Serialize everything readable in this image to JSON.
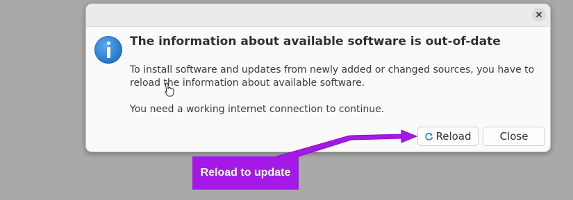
{
  "dialog": {
    "close_icon": "close-icon",
    "info_icon": "info-icon",
    "heading": "The information about available software is out-of-date",
    "paragraph1": "To install software and updates from newly added or changed sources, you have to reload the information about available software.",
    "paragraph2": "You need a working internet connection to continue.",
    "buttons": {
      "reload_label": "Reload",
      "reload_icon": "refresh-icon",
      "close_label": "Close"
    }
  },
  "annotation": {
    "label": "Reload to update",
    "color": "#a419e6"
  },
  "colors": {
    "background": "#a9a9a9",
    "dialog_bg": "#fafafa",
    "accent_blue": "#2e80d3"
  }
}
